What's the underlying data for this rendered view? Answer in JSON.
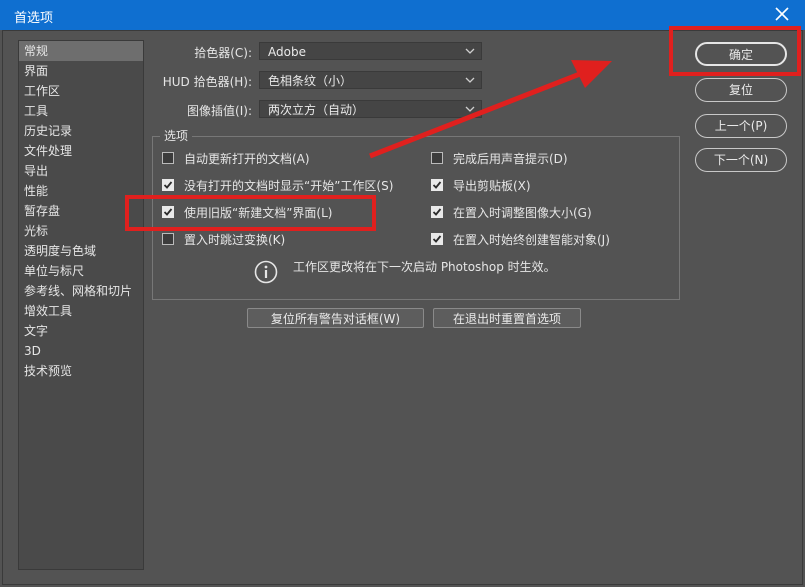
{
  "window": {
    "title": "首选项"
  },
  "sidebar": {
    "items": [
      "常规",
      "界面",
      "工作区",
      "工具",
      "历史记录",
      "文件处理",
      "导出",
      "性能",
      "暂存盘",
      "光标",
      "透明度与色域",
      "单位与标尺",
      "参考线、网格和切片",
      "增效工具",
      "文字",
      "3D",
      "技术预览"
    ],
    "selected_index": 0
  },
  "fields": {
    "color_picker": {
      "label": "拾色器(C):",
      "value": "Adobe"
    },
    "hud_picker": {
      "label": "HUD 拾色器(H):",
      "value": "色相条纹（小）"
    },
    "interpolation": {
      "label": "图像插值(I):",
      "value": "两次立方（自动）"
    }
  },
  "options": {
    "title": "选项",
    "left": [
      {
        "label": "自动更新打开的文档(A)",
        "checked": false
      },
      {
        "label": "没有打开的文档时显示“开始”工作区(S)",
        "checked": true
      },
      {
        "label": "使用旧版“新建文档”界面(L)",
        "checked": true
      },
      {
        "label": "置入时跳过变换(K)",
        "checked": false
      }
    ],
    "right": [
      {
        "label": "完成后用声音提示(D)",
        "checked": false
      },
      {
        "label": "导出剪贴板(X)",
        "checked": true
      },
      {
        "label": "在置入时调整图像大小(G)",
        "checked": true
      },
      {
        "label": "在置入时始终创建智能对象(J)",
        "checked": true
      }
    ],
    "info": "工作区更改将在下一次启动 Photoshop 时生效。"
  },
  "bottom_buttons": {
    "reset_warnings": "复位所有警告对话框(W)",
    "reset_on_quit": "在退出时重置首选项"
  },
  "side_buttons": {
    "ok": "确定",
    "reset": "复位",
    "prev": "上一个(P)",
    "next": "下一个(N)"
  },
  "colors": {
    "titlebar": "#0f6fd0",
    "background": "#535353",
    "annotation": "#e0201e"
  }
}
